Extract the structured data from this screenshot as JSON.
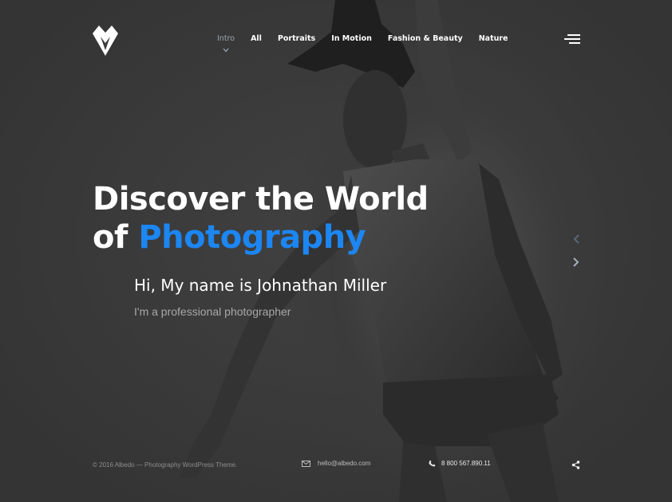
{
  "nav": {
    "items": [
      {
        "label": "Intro",
        "active": true
      },
      {
        "label": "All"
      },
      {
        "label": "Portraits"
      },
      {
        "label": "In Motion"
      },
      {
        "label": "Fashion & Beauty"
      },
      {
        "label": "Nature"
      }
    ]
  },
  "hero": {
    "title_line1": "Discover the World",
    "title_of": "of",
    "title_accent": "Photography",
    "subtitle": "Hi, My name is Johnathan Miller",
    "tagline": "I'm a professional photographer"
  },
  "footer": {
    "copyright": "© 2016 Albedo — Photography WordPress Theme.",
    "email": "hello@albedo.com",
    "phone": "8 800 567.890.11"
  },
  "colors": {
    "accent": "#1c86f2",
    "background": "#3a3a3a",
    "active_nav": "#9aa3ab"
  },
  "icons": [
    "logo-icon",
    "chevron-down-icon",
    "menu-icon",
    "arrow-up-icon",
    "arrow-down-icon",
    "mail-icon",
    "phone-icon",
    "share-icon"
  ]
}
